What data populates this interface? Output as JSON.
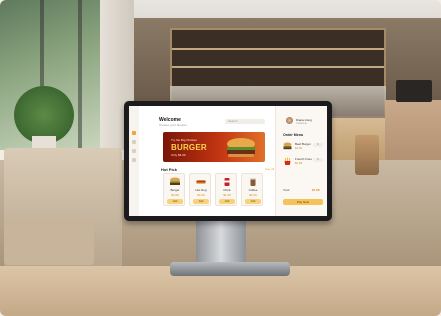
{
  "kiosk": {
    "welcome": "Welcome",
    "subtitle": "Choose your favorite",
    "search_placeholder": "Search",
    "banner": {
      "top": "Try the Big Chicken",
      "main": "BURGER",
      "sub": "Only $6.99"
    },
    "section_title": "Hot Pick",
    "see_all": "See all",
    "products": [
      {
        "name": "Burger",
        "price": "$4.99",
        "button": "Add",
        "icon": "burger-icon"
      },
      {
        "name": "Hot Dog",
        "price": "$3.49",
        "button": "Add",
        "icon": "hotdog-icon"
      },
      {
        "name": "Drink",
        "price": "$1.99",
        "button": "Add",
        "icon": "drink-icon"
      },
      {
        "name": "Coffee",
        "price": "$2.49",
        "button": "Add",
        "icon": "coffee-icon"
      }
    ],
    "order": {
      "user_name": "Diana Hong",
      "user_role": "Customer",
      "title": "Order Menu",
      "items": [
        {
          "name": "Beef Burger",
          "price": "$4.99",
          "qty": "1",
          "icon": "burger-icon"
        },
        {
          "name": "French Fries",
          "price": "$2.99",
          "qty": "1",
          "icon": "fries-icon"
        }
      ],
      "total_label": "Total",
      "total_value": "$7.98",
      "pay_button": "Pay Now"
    }
  },
  "colors": {
    "accent": "#f2a33a",
    "banner": "#c23512",
    "price": "#e0891b"
  }
}
